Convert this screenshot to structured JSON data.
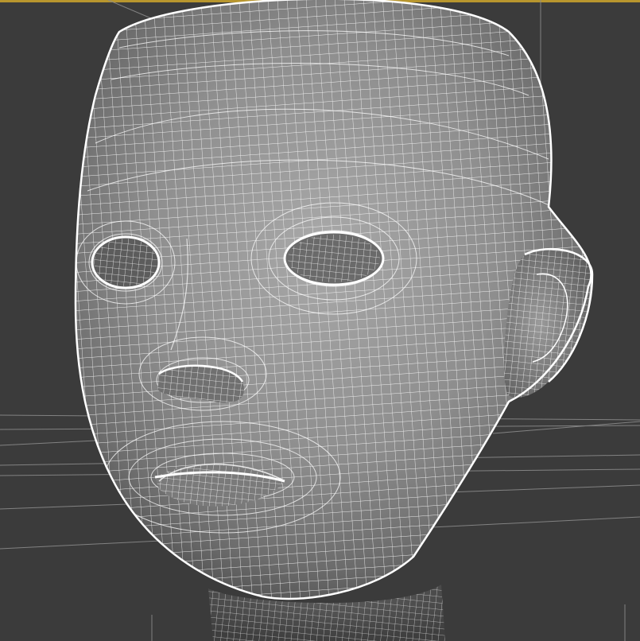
{
  "viewport": {
    "active_border_color": "#b8962e",
    "background_color": "#3b3b3b",
    "shading": "smooth-with-wireframe-edges",
    "wire_color": "#ffffff"
  },
  "scene": {
    "object": "head-mesh",
    "grid_color": "#8a8a8a"
  }
}
